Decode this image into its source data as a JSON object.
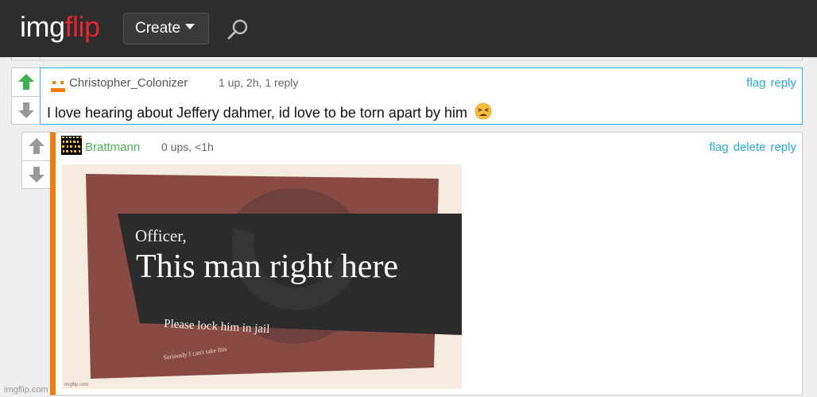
{
  "header": {
    "logo_part1": "img",
    "logo_part2": "flip",
    "create_label": "Create",
    "search_icon": "search-icon"
  },
  "comments": [
    {
      "username": "Christopher_Colonizer",
      "meta": "1 up, 2h, 1 reply",
      "actions": [
        "flag",
        "reply"
      ],
      "text": "I love hearing about Jeffery dahmer, id love to be torn apart by him",
      "emoji": "tired-face-emoji"
    },
    {
      "username": "Brattmann",
      "meta": "0 ups, <1h",
      "actions": [
        "flag",
        "delete",
        "reply"
      ],
      "meme": {
        "line1": "Officer,",
        "line2": "This man right here",
        "line3": "Please lock him in jail",
        "line4": "Seriously I can't take this",
        "watermark": "imgflip.com"
      }
    }
  ],
  "footer_watermark": "imgflip.com",
  "colors": {
    "accent_blue": "#29b6e6",
    "upvote_green": "#3bb34a",
    "brand_red": "#e6262e",
    "reply_bar_orange": "#f47b0f",
    "username_green": "#4caf50"
  }
}
